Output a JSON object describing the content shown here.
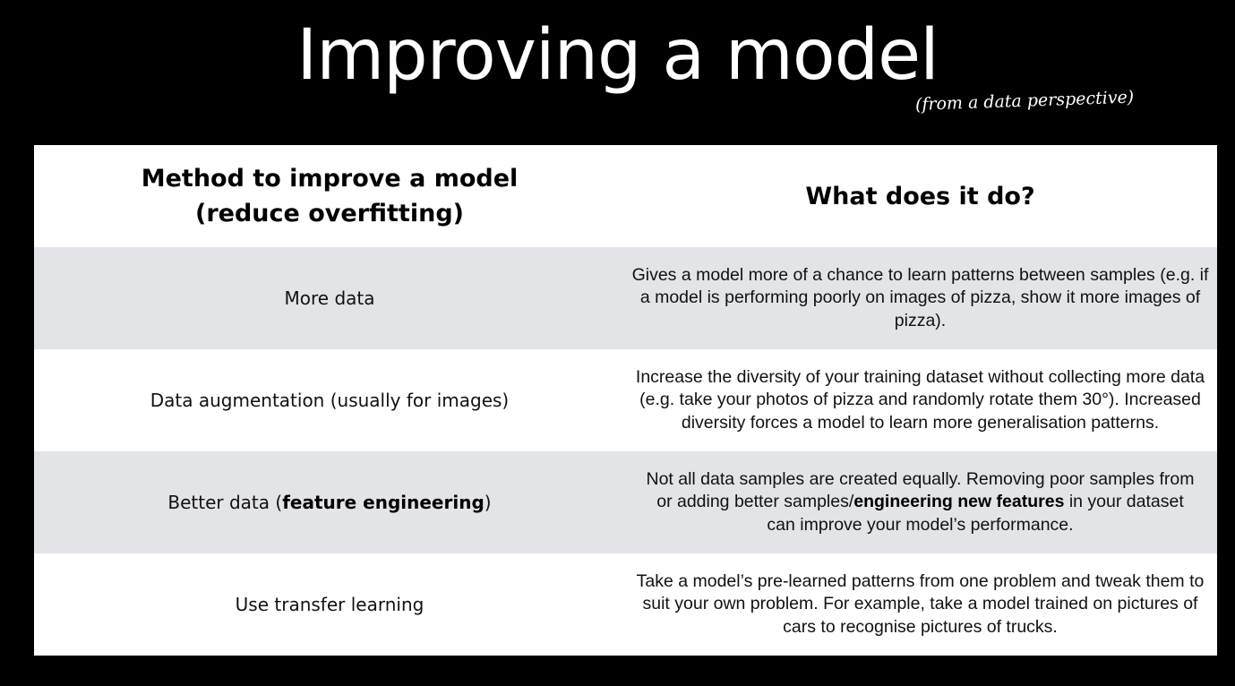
{
  "title": "Improving a model",
  "subtitle": "(from a data perspective)",
  "table": {
    "headers": {
      "method": "Method to improve a model (reduce overfitting)",
      "what": "What does it do?"
    },
    "rows": [
      {
        "method": "More data",
        "description": "Gives a model more of a chance to learn patterns between samples (e.g. if a model is performing poorly on images of pizza, show it more images of pizza)."
      },
      {
        "method": "Data augmentation (usually for images)",
        "description": "Increase the diversity of your training dataset without collecting more data (e.g. take your photos of pizza and randomly rotate them 30°). Increased diversity forces a model to learn more generalisation patterns."
      },
      {
        "method_prefix": "Better data (",
        "method_bold": "feature engineering",
        "method_suffix": ")",
        "description_prefix": "Not all data samples are created equally. Removing poor samples from or adding better samples/",
        "description_bold": "engineering new features",
        "description_suffix": " in your dataset can improve your model’s performance."
      },
      {
        "method": "Use transfer learning",
        "description": "Take a model’s pre-learned patterns from one problem and tweak them to suit your own problem. For example, take a model trained on pictures of cars to recognise pictures of trucks."
      }
    ]
  },
  "colors": {
    "background": "#000000",
    "title_text": "#ffffff",
    "row_shaded": "#e3e4e8",
    "row_plain": "#ffffff"
  }
}
